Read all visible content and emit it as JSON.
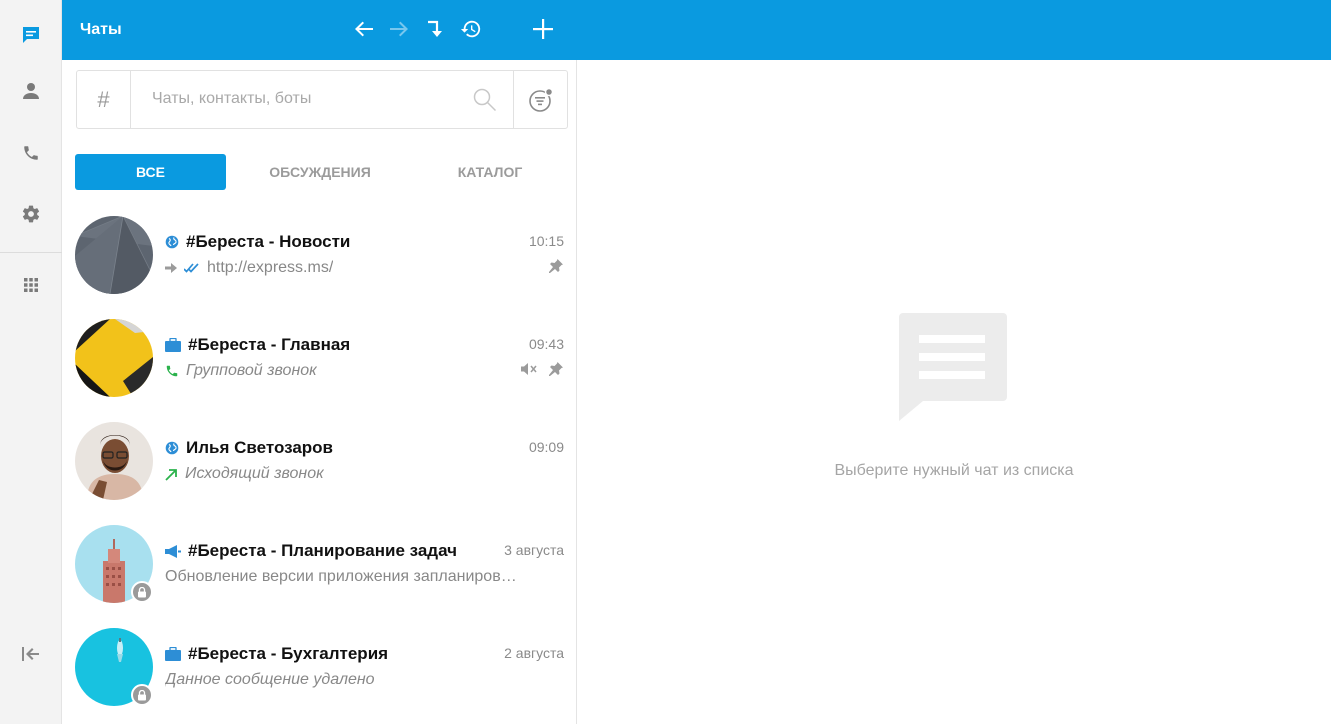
{
  "rail": {
    "items": [
      {
        "name": "chats",
        "icon": "chat-icon",
        "active": true
      },
      {
        "name": "contacts",
        "icon": "person-icon"
      },
      {
        "name": "calls",
        "icon": "phone-icon"
      },
      {
        "name": "settings",
        "icon": "gear-icon"
      },
      {
        "name": "apps",
        "icon": "grid-icon"
      }
    ],
    "collapse_icon": "collapse-left-icon"
  },
  "header": {
    "title": "Чаты",
    "buttons": [
      "back-arrow-icon",
      "forward-arrow-icon",
      "jump-icon",
      "history-icon",
      "plus-icon"
    ]
  },
  "search": {
    "hash": "#",
    "placeholder": "Чаты, контакты, боты"
  },
  "tabs": [
    {
      "label": "ВСЕ",
      "active": true
    },
    {
      "label": "ОБСУЖДЕНИЯ",
      "active": false
    },
    {
      "label": "КАТАЛОГ",
      "active": false
    }
  ],
  "chats": [
    {
      "title": "#Береста - Новости",
      "time": "10:15",
      "subtitle": "http://express.ms/",
      "type_icon": "globe-icon",
      "sub_icons": [
        "forwarded-icon",
        "double-check-icon"
      ],
      "pinned": true,
      "muted": false
    },
    {
      "title": "#Береста - Главная",
      "time": "09:43",
      "subtitle": "Групповой звонок",
      "type_icon": "briefcase-icon",
      "sub_icons": [
        "phone-icon"
      ],
      "pinned": true,
      "muted": true
    },
    {
      "title": "Илья Светозаров",
      "time": "09:09",
      "subtitle": "Исходящий звонок",
      "type_icon": "globe-icon",
      "sub_icons": [
        "outgoing-call-icon"
      ],
      "pinned": false,
      "muted": false
    },
    {
      "title": "#Береста - Планирование задач",
      "time": "3 августа",
      "subtitle": "Обновление версии приложения запланиров…",
      "type_icon": "megaphone-icon",
      "sub_icons": [],
      "pinned": false,
      "muted": false,
      "locked": true
    },
    {
      "title": "#Береста - Бухгалтерия",
      "time": "2 августа",
      "subtitle": "Данное сообщение удалено",
      "type_icon": "briefcase-icon",
      "sub_icons": [],
      "pinned": false,
      "muted": false,
      "locked": true
    }
  ],
  "empty_state": {
    "icon": "message-icon",
    "text": "Выберите нужный чат из списка"
  },
  "colors": {
    "accent": "#0a9ae0",
    "green": "#2bb24c",
    "check_blue": "#2d8ed6",
    "muted_text": "#888888"
  }
}
